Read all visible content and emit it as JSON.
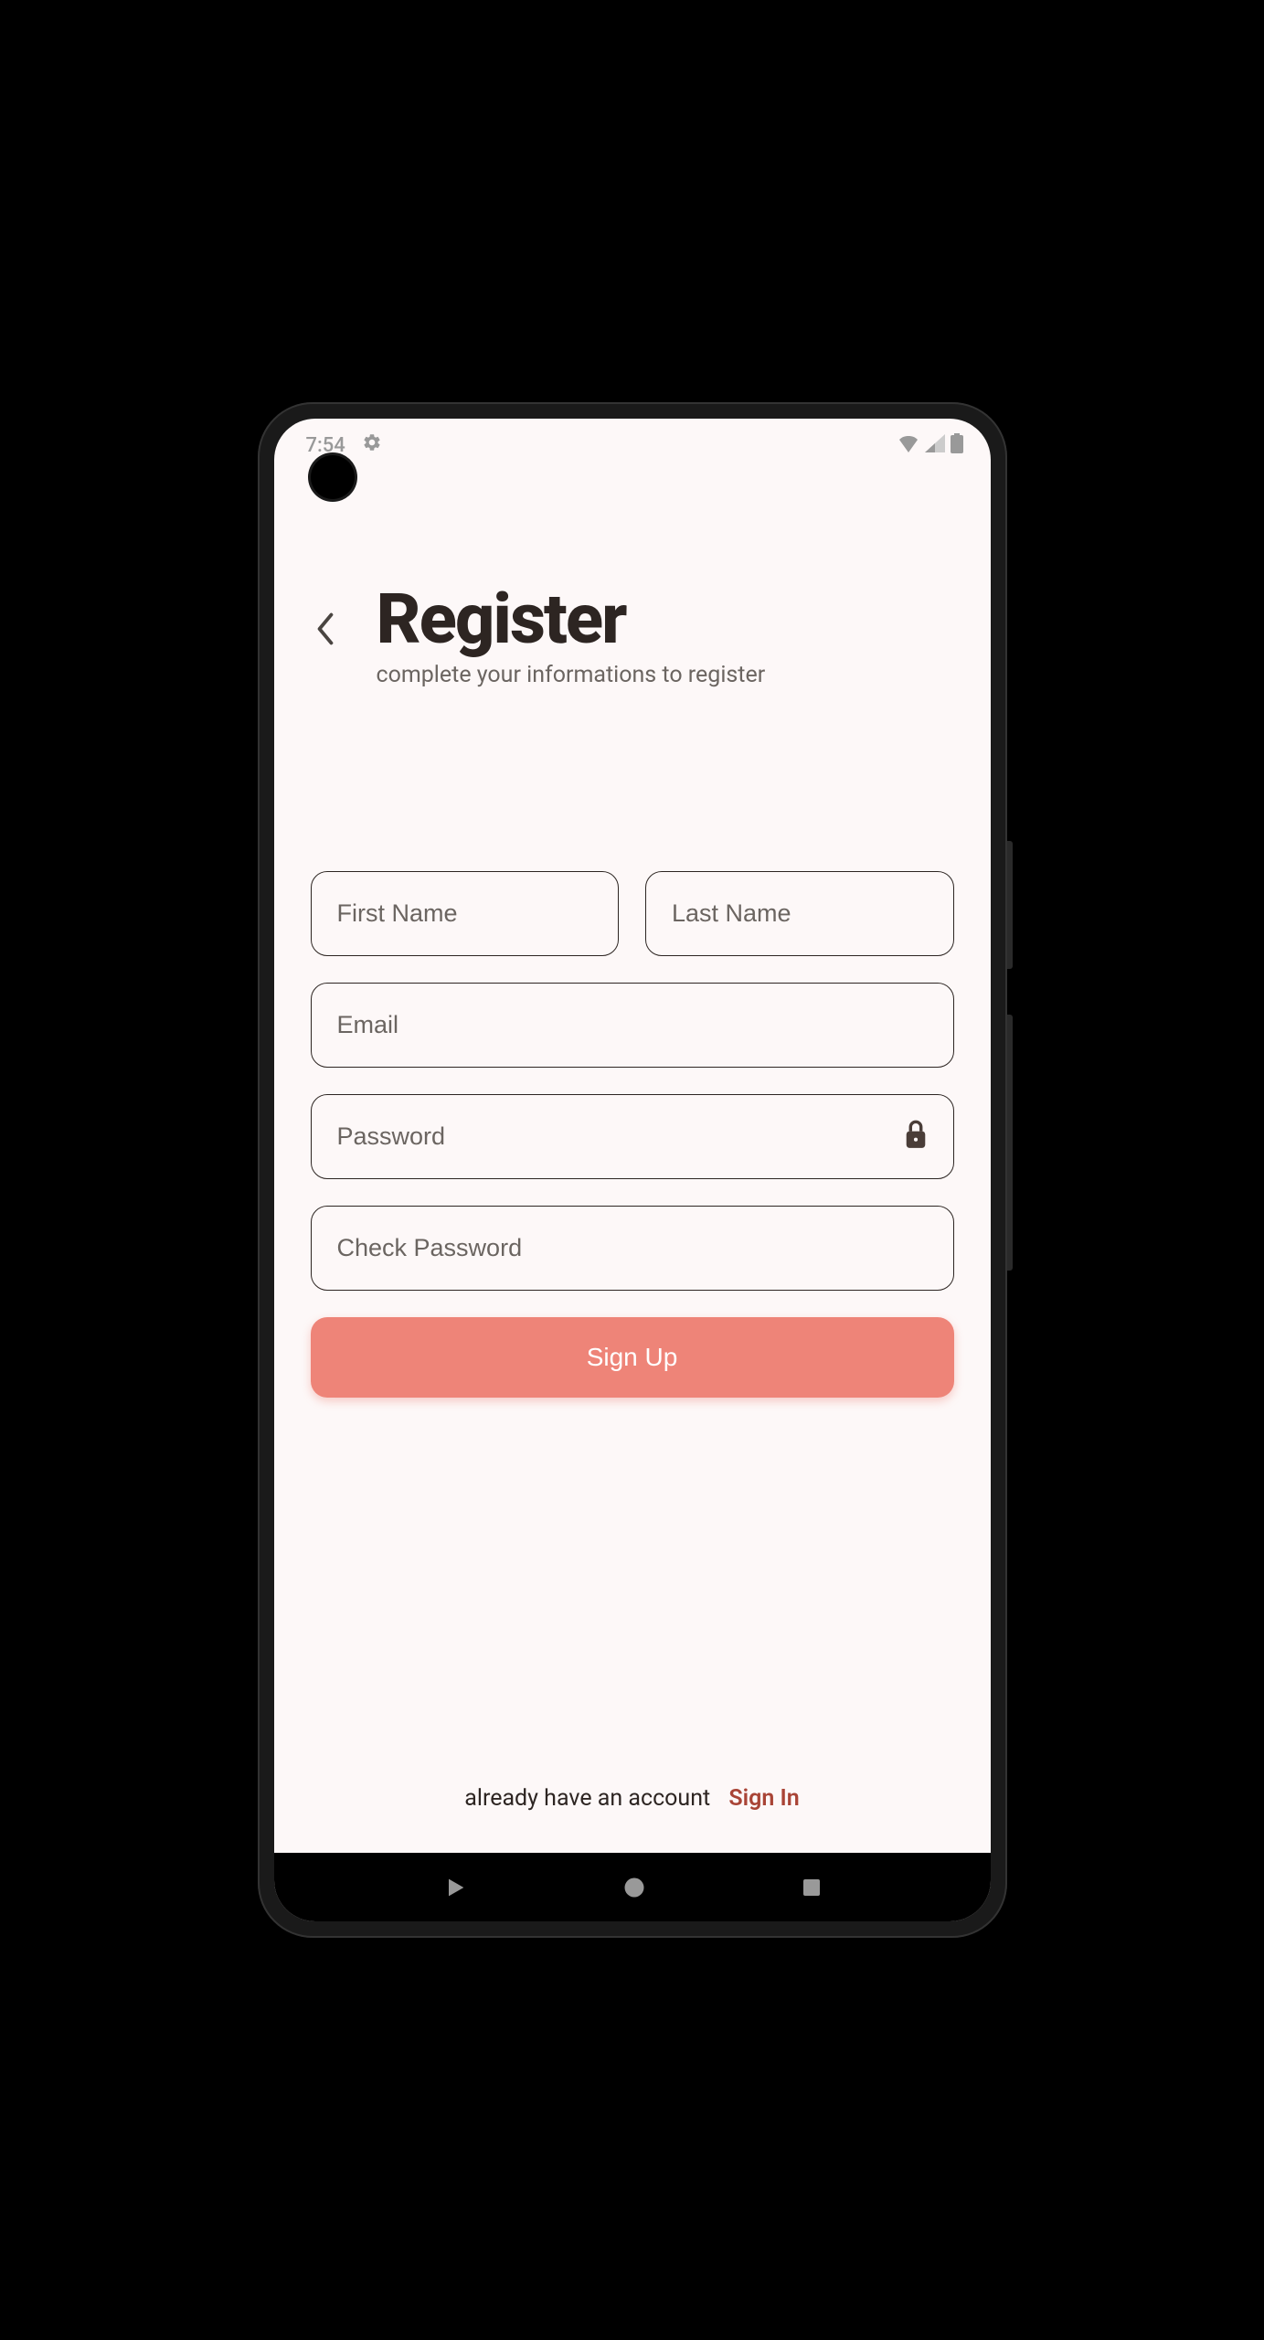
{
  "status_bar": {
    "time": "7:54"
  },
  "header": {
    "title": "Register",
    "subtitle": "complete your informations to register"
  },
  "form": {
    "first_name_placeholder": "First Name",
    "last_name_placeholder": "Last Name",
    "email_placeholder": "Email",
    "password_placeholder": "Password",
    "check_password_placeholder": "Check Password",
    "signup_label": "Sign Up"
  },
  "footer": {
    "prompt": "already have an account",
    "signin_label": "Sign In"
  }
}
